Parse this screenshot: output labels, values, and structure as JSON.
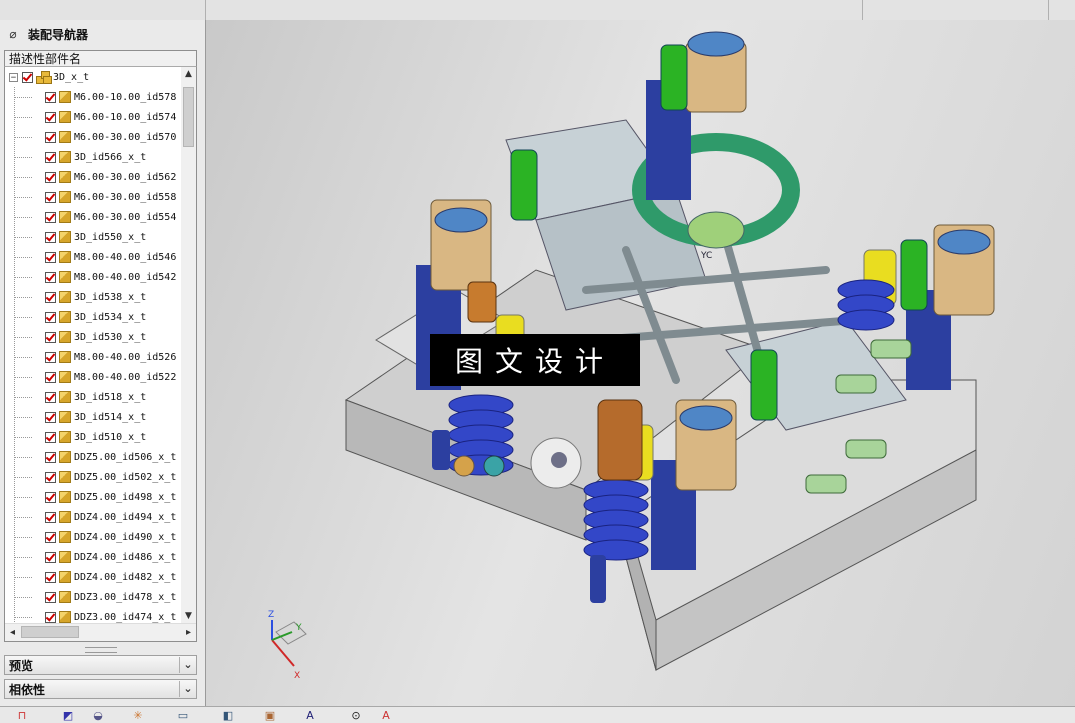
{
  "navigator": {
    "title": "装配导航器",
    "column_header": "描述性部件名",
    "root": "3D_x_t",
    "items": [
      "M6.00-10.00_id578",
      "M6.00-10.00_id574",
      "M6.00-30.00_id570",
      "3D_id566_x_t",
      "M6.00-30.00_id562",
      "M6.00-30.00_id558",
      "M6.00-30.00_id554",
      "3D_id550_x_t",
      "M8.00-40.00_id546",
      "M8.00-40.00_id542",
      "3D_id538_x_t",
      "3D_id534_x_t",
      "3D_id530_x_t",
      "M8.00-40.00_id526",
      "M8.00-40.00_id522",
      "3D_id518_x_t",
      "3D_id514_x_t",
      "3D_id510_x_t",
      "DDZ5.00_id506_x_t",
      "DDZ5.00_id502_x_t",
      "DDZ5.00_id498_x_t",
      "DDZ4.00_id494_x_t",
      "DDZ4.00_id490_x_t",
      "DDZ4.00_id486_x_t",
      "DDZ4.00_id482_x_t",
      "DDZ3.00_id478_x_t",
      "DDZ3.00_id474_x_t"
    ]
  },
  "panels": {
    "preview": "预览",
    "dependency": "相依性"
  },
  "watermark": "图文设计",
  "axes": {
    "x": "X",
    "y": "Y",
    "z": "Z",
    "yc": "YC"
  },
  "icons": {
    "pin": "pin-icon",
    "expand": "minus-icon",
    "component": "component-cube-icon",
    "assembly": "assembly-icon"
  },
  "colors": {
    "check": "#cc0000",
    "part": "#e8b93a",
    "background": "#d6d6d6"
  }
}
